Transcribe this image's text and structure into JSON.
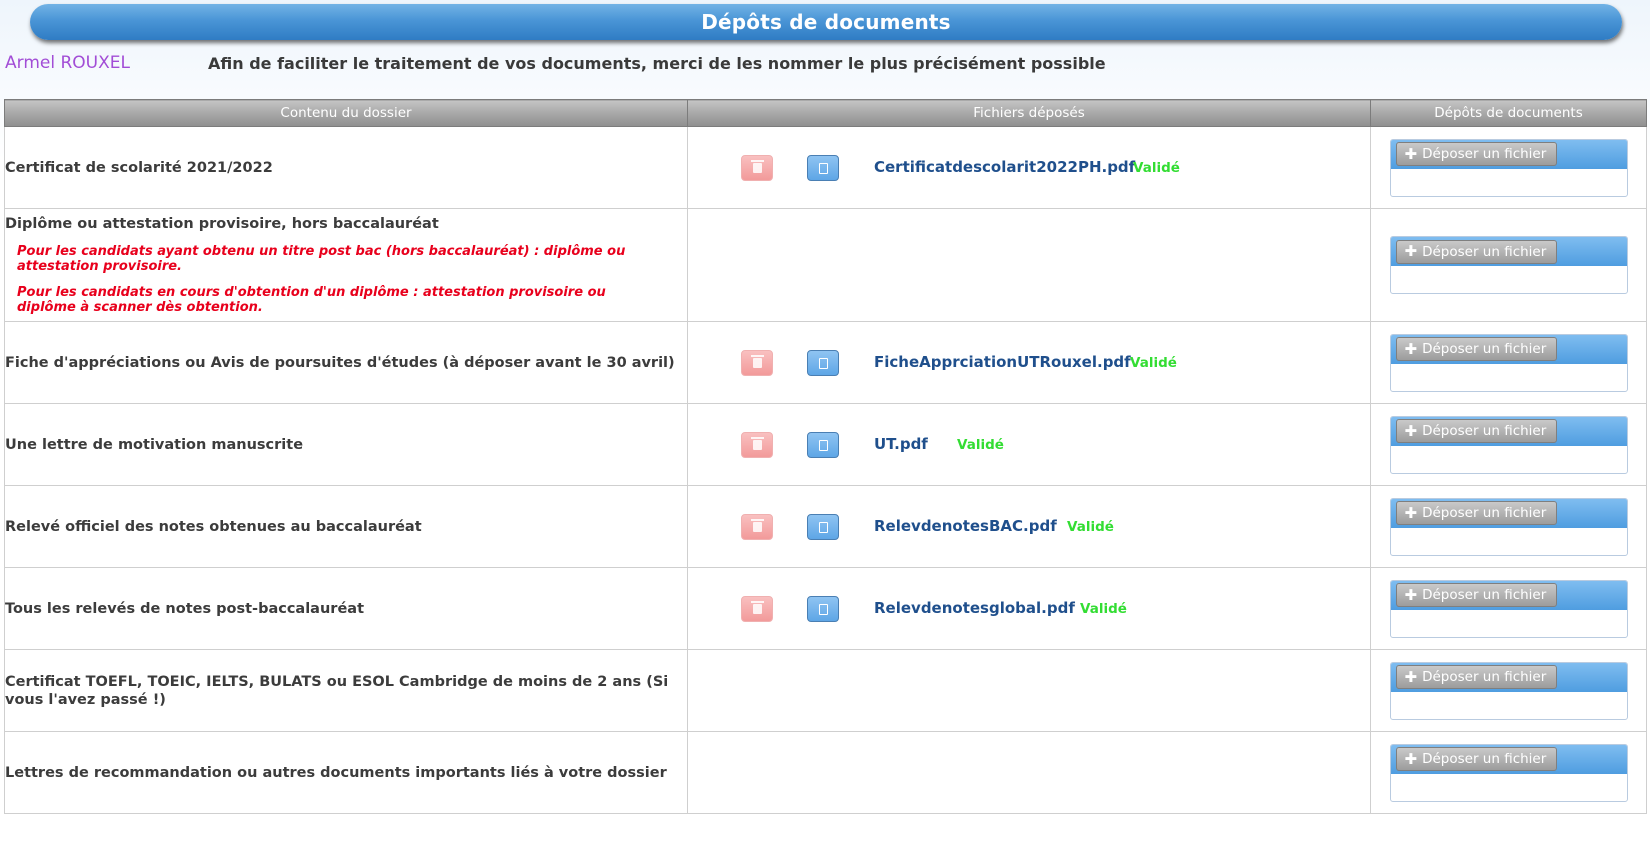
{
  "header": {
    "title": "Dépôts de documents"
  },
  "user": {
    "name": "Armel ROUXEL"
  },
  "intro": "Afin de faciliter le traitement de vos documents, merci de les nommer le plus précisément possible",
  "table": {
    "columns": [
      "Contenu du dossier",
      "Fichiers déposés",
      "Dépôts de documents"
    ],
    "upload_label": "Déposer un fichier",
    "rows": [
      {
        "label": "Certificat de scolarité 2021/2022",
        "file": "Certificatdescolarit2022PH.pdf",
        "status": "Validé"
      },
      {
        "label": "Diplôme ou attestation provisoire, hors baccalauréat",
        "notes": [
          "Pour les candidats ayant obtenu un titre post bac (hors baccalauréat) : diplôme ou attestation provisoire.",
          "Pour les candidats en cours d'obtention d'un diplôme : attestation provisoire ou diplôme à scanner dès obtention."
        ]
      },
      {
        "label": "Fiche d'appréciations ou Avis de poursuites d'études (à déposer avant le 30 avril)",
        "file": "FicheApprciationUTRouxel.pdf",
        "status": "Validé"
      },
      {
        "label": "Une lettre de motivation manuscrite",
        "file": "UT.pdf",
        "status": "Validé"
      },
      {
        "label": "Relevé officiel des notes obtenues au baccalauréat",
        "file": "RelevdenotesBAC.pdf",
        "status": "Validé"
      },
      {
        "label": "Tous les relevés de notes post-baccalauréat",
        "file": "Relevdenotesglobal.pdf",
        "status": "Validé"
      },
      {
        "label": "Certificat TOEFL, TOEIC, IELTS, BULATS ou ESOL Cambridge de moins de 2 ans (Si vous l'avez passé !)"
      },
      {
        "label": "Lettres de recommandation ou autres documents importants liés à votre dossier"
      }
    ]
  },
  "colors": {
    "banner": "#4a95d6",
    "user": "#a24dd6",
    "status": "#33dd33",
    "note": "#e8001c",
    "file_link": "#1f4f8c"
  }
}
